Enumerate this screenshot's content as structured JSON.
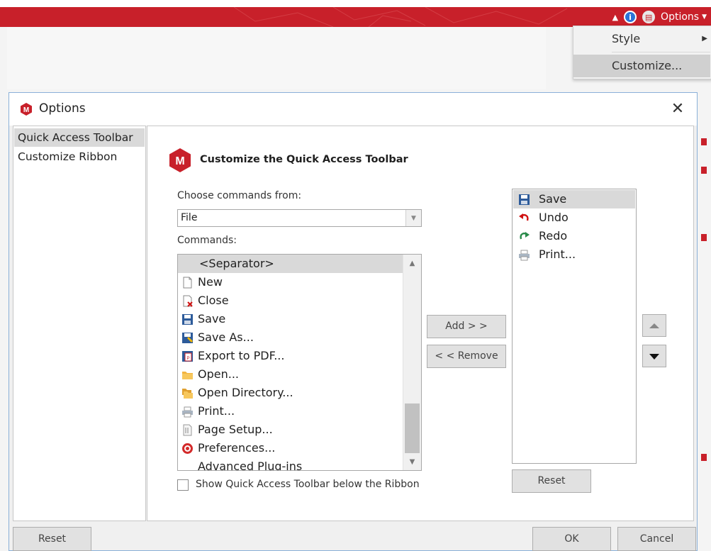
{
  "app": {
    "menu_button": "Options",
    "dropdown": {
      "style": "Style",
      "customize": "Customize..."
    },
    "colors": {
      "ribbon": "#c8202a",
      "accent": "#2b74d8"
    }
  },
  "dialog": {
    "title": "Options",
    "nav": [
      {
        "label": "Quick Access Toolbar",
        "selected": true
      },
      {
        "label": "Customize Ribbon",
        "selected": false
      }
    ],
    "header_title": "Customize the Quick Access Toolbar",
    "choose_label": "Choose commands from:",
    "choose_value": "File",
    "commands_label": "Commands:",
    "commands": [
      {
        "label": "<Separator>",
        "icon": "none",
        "selected": true
      },
      {
        "label": "New",
        "icon": "new-document-icon"
      },
      {
        "label": "Close",
        "icon": "close-document-icon"
      },
      {
        "label": "Save",
        "icon": "save-icon"
      },
      {
        "label": "Save As...",
        "icon": "save-as-icon"
      },
      {
        "label": "Export to PDF...",
        "icon": "pdf-icon"
      },
      {
        "label": "Open...",
        "icon": "folder-icon"
      },
      {
        "label": "Open Directory...",
        "icon": "folder-directory-icon"
      },
      {
        "label": "Print...",
        "icon": "printer-icon"
      },
      {
        "label": "Page Setup...",
        "icon": "page-setup-icon"
      },
      {
        "label": "Preferences...",
        "icon": "preferences-icon"
      },
      {
        "label": "Advanced Plug-ins",
        "icon": "none"
      }
    ],
    "add_label": "Add > >",
    "remove_label": "< < Remove",
    "qat_items": [
      {
        "label": "Save",
        "icon": "save-icon",
        "selected": true
      },
      {
        "label": "Undo",
        "icon": "undo-icon"
      },
      {
        "label": "Redo",
        "icon": "redo-icon"
      },
      {
        "label": "Print...",
        "icon": "printer-icon"
      }
    ],
    "qat_reset_label": "Reset",
    "checkbox_label": "Show Quick Access Toolbar below the Ribbon",
    "checkbox_checked": false,
    "reset_label": "Reset",
    "ok_label": "OK",
    "cancel_label": "Cancel"
  }
}
